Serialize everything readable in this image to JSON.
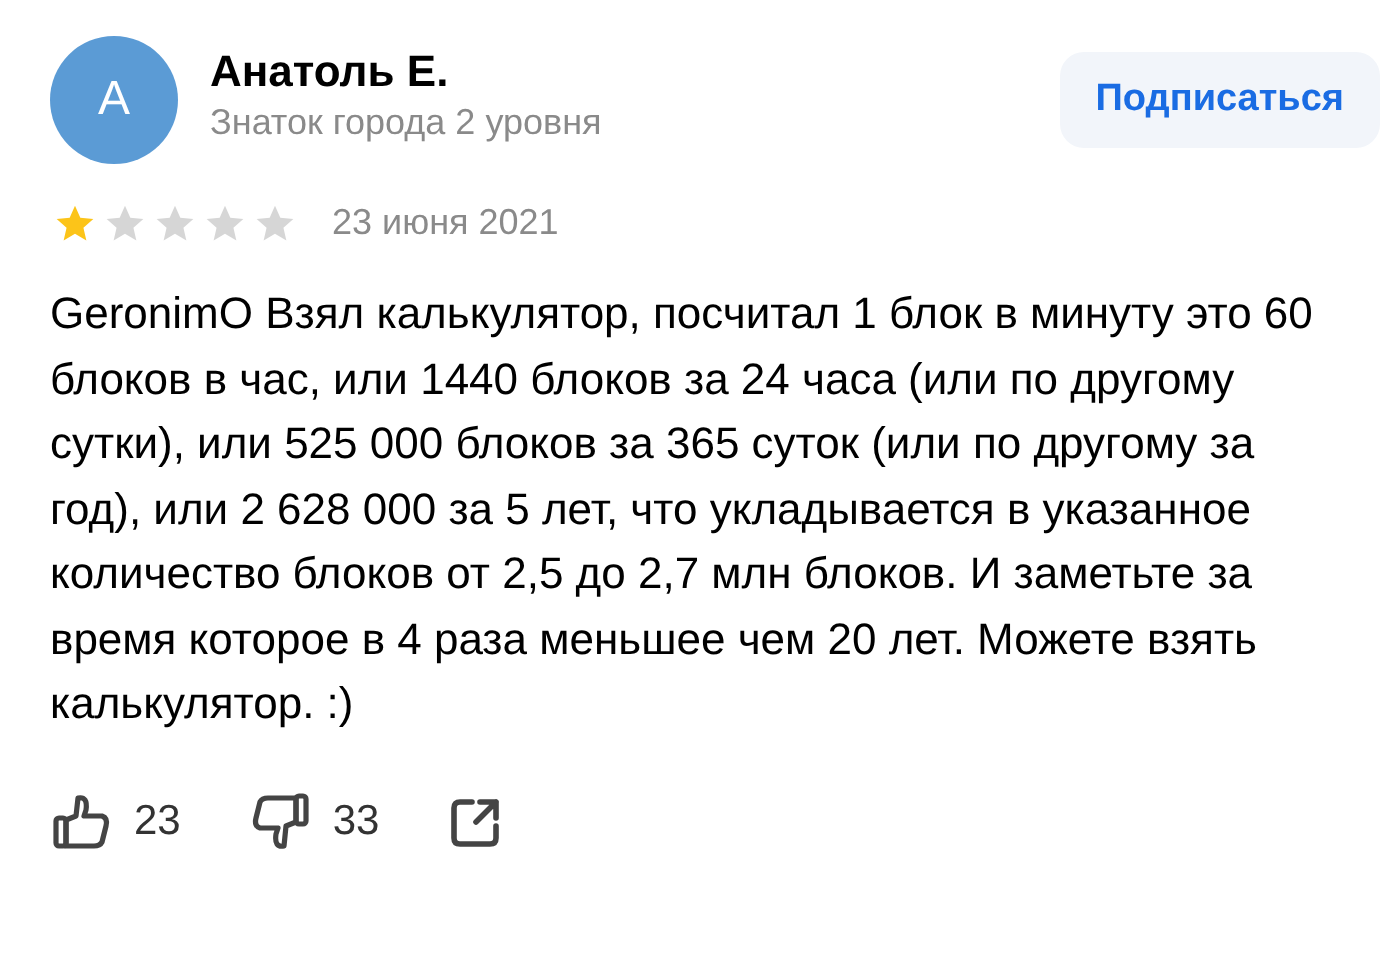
{
  "author": {
    "initial": "А",
    "name": "Анатоль Е.",
    "status": "Знаток города 2 уровня"
  },
  "subscribe_button": "Подписаться",
  "rating": {
    "stars": 1
  },
  "date": "23 июня 2021",
  "text": "GeronimO Взял калькулятор, посчитал 1 блок в минуту это 60 блоков в час, или 1440 блоков за 24 часа (или по другому сутки), или 525 000 блоков за 365 суток (или по другому за год), или 2 628 000 за 5 лет, что укладывается в указанное количество блоков от 2,5 до 2,7 млн блоков. И заметьте за время которое в 4 раза меньшее чем 20 лет. Можете взять калькулятор. :)",
  "likes": "23",
  "dislikes": "33"
}
